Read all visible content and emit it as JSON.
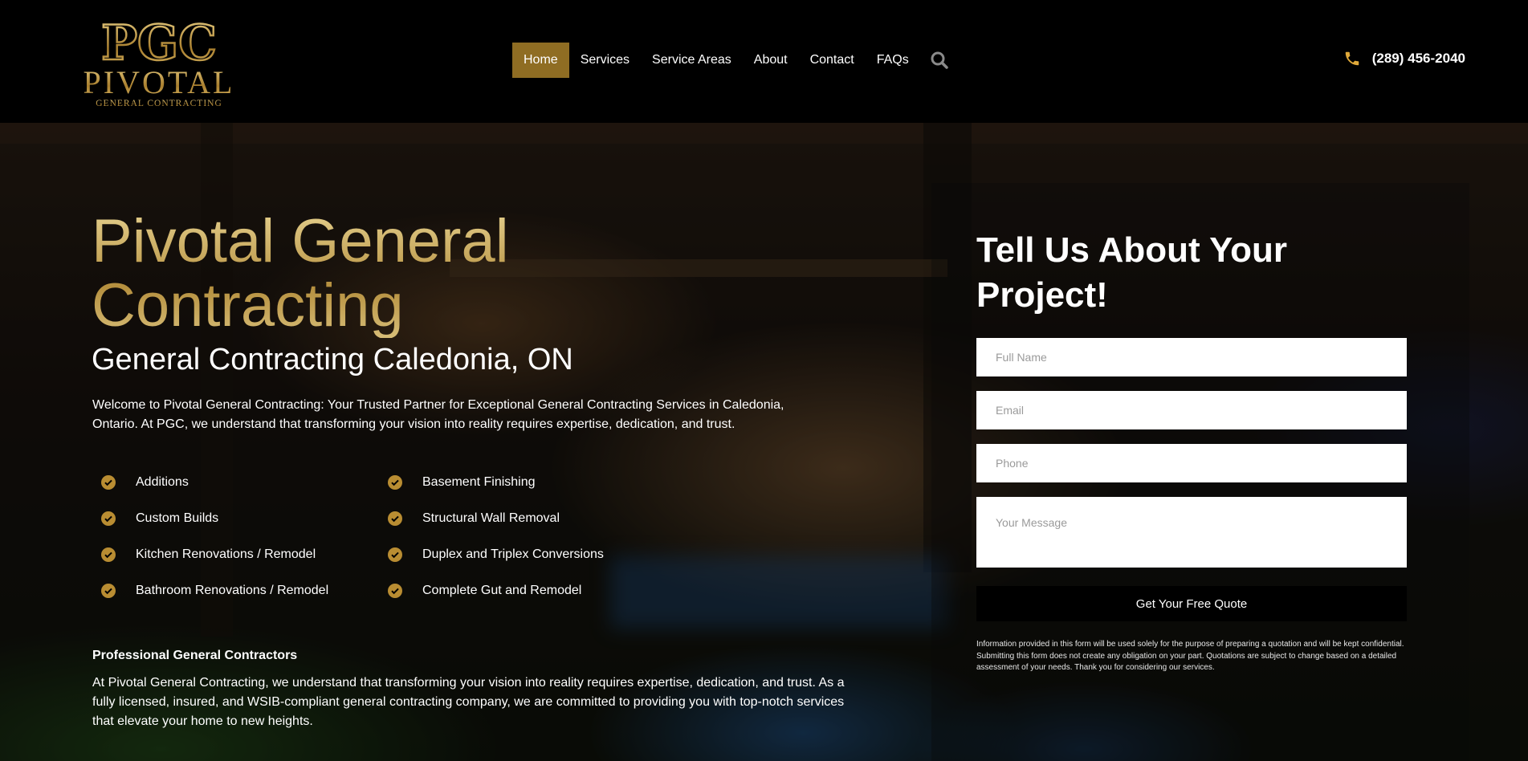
{
  "logo": {
    "monogram": "PGC",
    "name": "PIVOTAL",
    "tagline": "GENERAL CONTRACTING",
    "gold": "#c9a24a"
  },
  "nav": {
    "items": [
      "Home",
      "Services",
      "Service Areas",
      "About",
      "Contact",
      "FAQs"
    ],
    "active": "Home",
    "search_icon": "search-icon"
  },
  "phone": {
    "number": "(289) 456-2040",
    "icon": "phone-icon"
  },
  "hero": {
    "title": "Pivotal General Contracting",
    "subtitle": "General Contracting Caledonia, ON",
    "intro": "Welcome to Pivotal General Contracting: Your Trusted Partner for Exceptional General Contracting Services in Caledonia, Ontario. At PGC, we understand that transforming your vision into reality requires expertise, dedication, and trust.",
    "features_left": [
      "Additions",
      "Custom Builds",
      "Kitchen Renovations / Remodel",
      "Bathroom Renovations / Remodel"
    ],
    "features_right": [
      "Basement Finishing",
      "Structural Wall Removal",
      "Duplex and Triplex Conversions",
      "Complete Gut and Remodel"
    ],
    "section_heading": "Professional General Contractors",
    "section_body": "At Pivotal General Contracting, we understand that transforming your vision into reality requires expertise, dedication, and trust. As a fully licensed, insured, and WSIB-compliant general contracting company, we are committed to providing you with top-notch services that elevate your home to new heights."
  },
  "form": {
    "title": "Tell Us About Your Project!",
    "placeholders": {
      "name": "Full Name",
      "email": "Email",
      "phone": "Phone",
      "message": "Your Message"
    },
    "submit_label": "Get Your Free Quote",
    "disclaimer": "Information provided in this form will be used solely for the purpose of preparing a quotation and will be kept confidential. Submitting this form does not create any obligation on your part. Quotations are subject to change based on a detailed assessment of your needs. Thank you for considering our services."
  },
  "colors": {
    "accent": "#8f6d23",
    "check": "#b98d32",
    "background": "#000000"
  }
}
